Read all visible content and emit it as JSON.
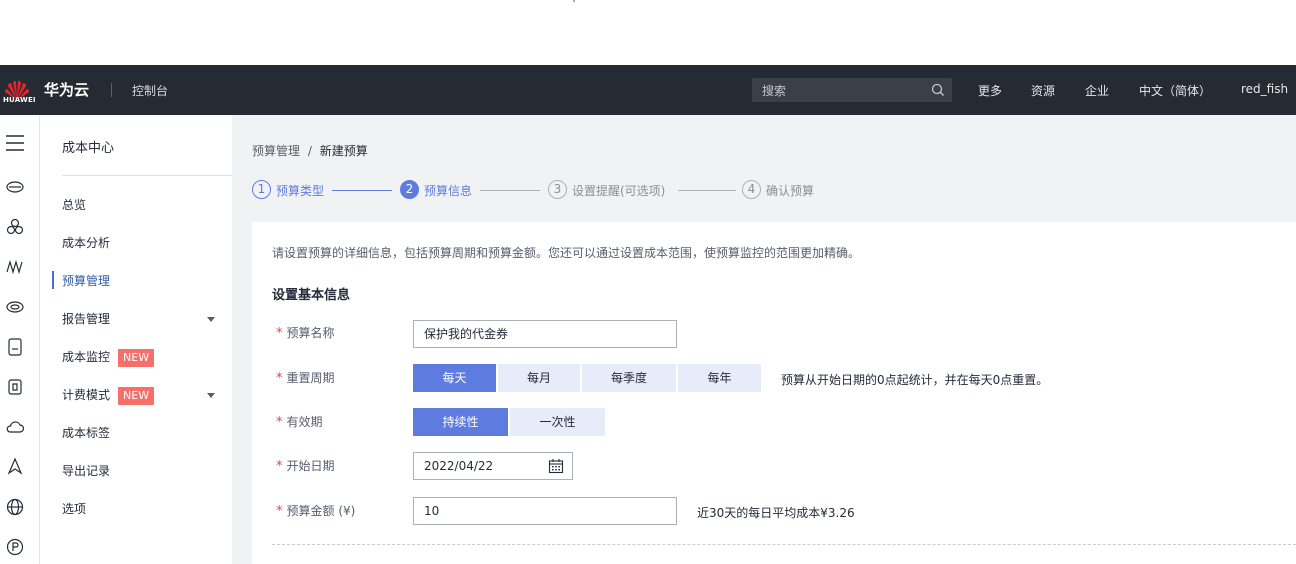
{
  "header": {
    "logo_text": "HUAWEI",
    "brand": "华为云",
    "console": "控制台",
    "search_placeholder": "搜索",
    "nav": [
      "更多",
      "资源",
      "企业",
      "中文（简体）",
      "red_fish"
    ]
  },
  "rail": {
    "icons": [
      "menu-icon",
      "cloud-server-icon",
      "cluster-icon",
      "network-icon",
      "database-icon",
      "storage-icon",
      "container-icon",
      "cloud-icon",
      "deploy-icon",
      "globe-icon",
      "p-icon"
    ]
  },
  "sidebar": {
    "title": "成本中心",
    "items": [
      {
        "label": "总览"
      },
      {
        "label": "成本分析"
      },
      {
        "label": "预算管理",
        "active": true
      },
      {
        "label": "报告管理",
        "expandable": true
      },
      {
        "label": "成本监控",
        "badge": "NEW"
      },
      {
        "label": "计费模式",
        "badge": "NEW",
        "expandable": true
      },
      {
        "label": "成本标签"
      },
      {
        "label": "导出记录"
      },
      {
        "label": "选项"
      }
    ]
  },
  "breadcrumb": {
    "parent": "预算管理",
    "separator": "/",
    "current": "新建预算"
  },
  "steps": [
    {
      "num": "1",
      "label": "预算类型",
      "state": "done"
    },
    {
      "num": "2",
      "label": "预算信息",
      "state": "current"
    },
    {
      "num": "3",
      "label": "设置提醒(可选项)",
      "state": "todo"
    },
    {
      "num": "4",
      "label": "确认预算",
      "state": "todo"
    }
  ],
  "form": {
    "description": "请设置预算的详细信息，包括预算周期和预算金额。您还可以通过设置成本范围，使预算监控的范围更加精确。",
    "section_title": "设置基本信息",
    "required_mark": "*",
    "name_label": "预算名称",
    "name_value": "保护我的代金券",
    "period_label": "重置周期",
    "period_options": [
      "每天",
      "每月",
      "每季度",
      "每年"
    ],
    "period_selected": "每天",
    "period_hint": "预算从开始日期的0点起统计，并在每天0点重置。",
    "validity_label": "有效期",
    "validity_options": [
      "持续性",
      "一次性"
    ],
    "validity_selected": "持续性",
    "start_label": "开始日期",
    "start_value": "2022/04/22",
    "amount_label": "预算金额 (¥)",
    "amount_value": "10",
    "amount_hint": "近30天的每日平均成本¥3.26"
  },
  "colors": {
    "topbar": "#252a33",
    "primary": "#5e7ce0",
    "required": "#e5453d",
    "badge": "#f66f6a"
  }
}
